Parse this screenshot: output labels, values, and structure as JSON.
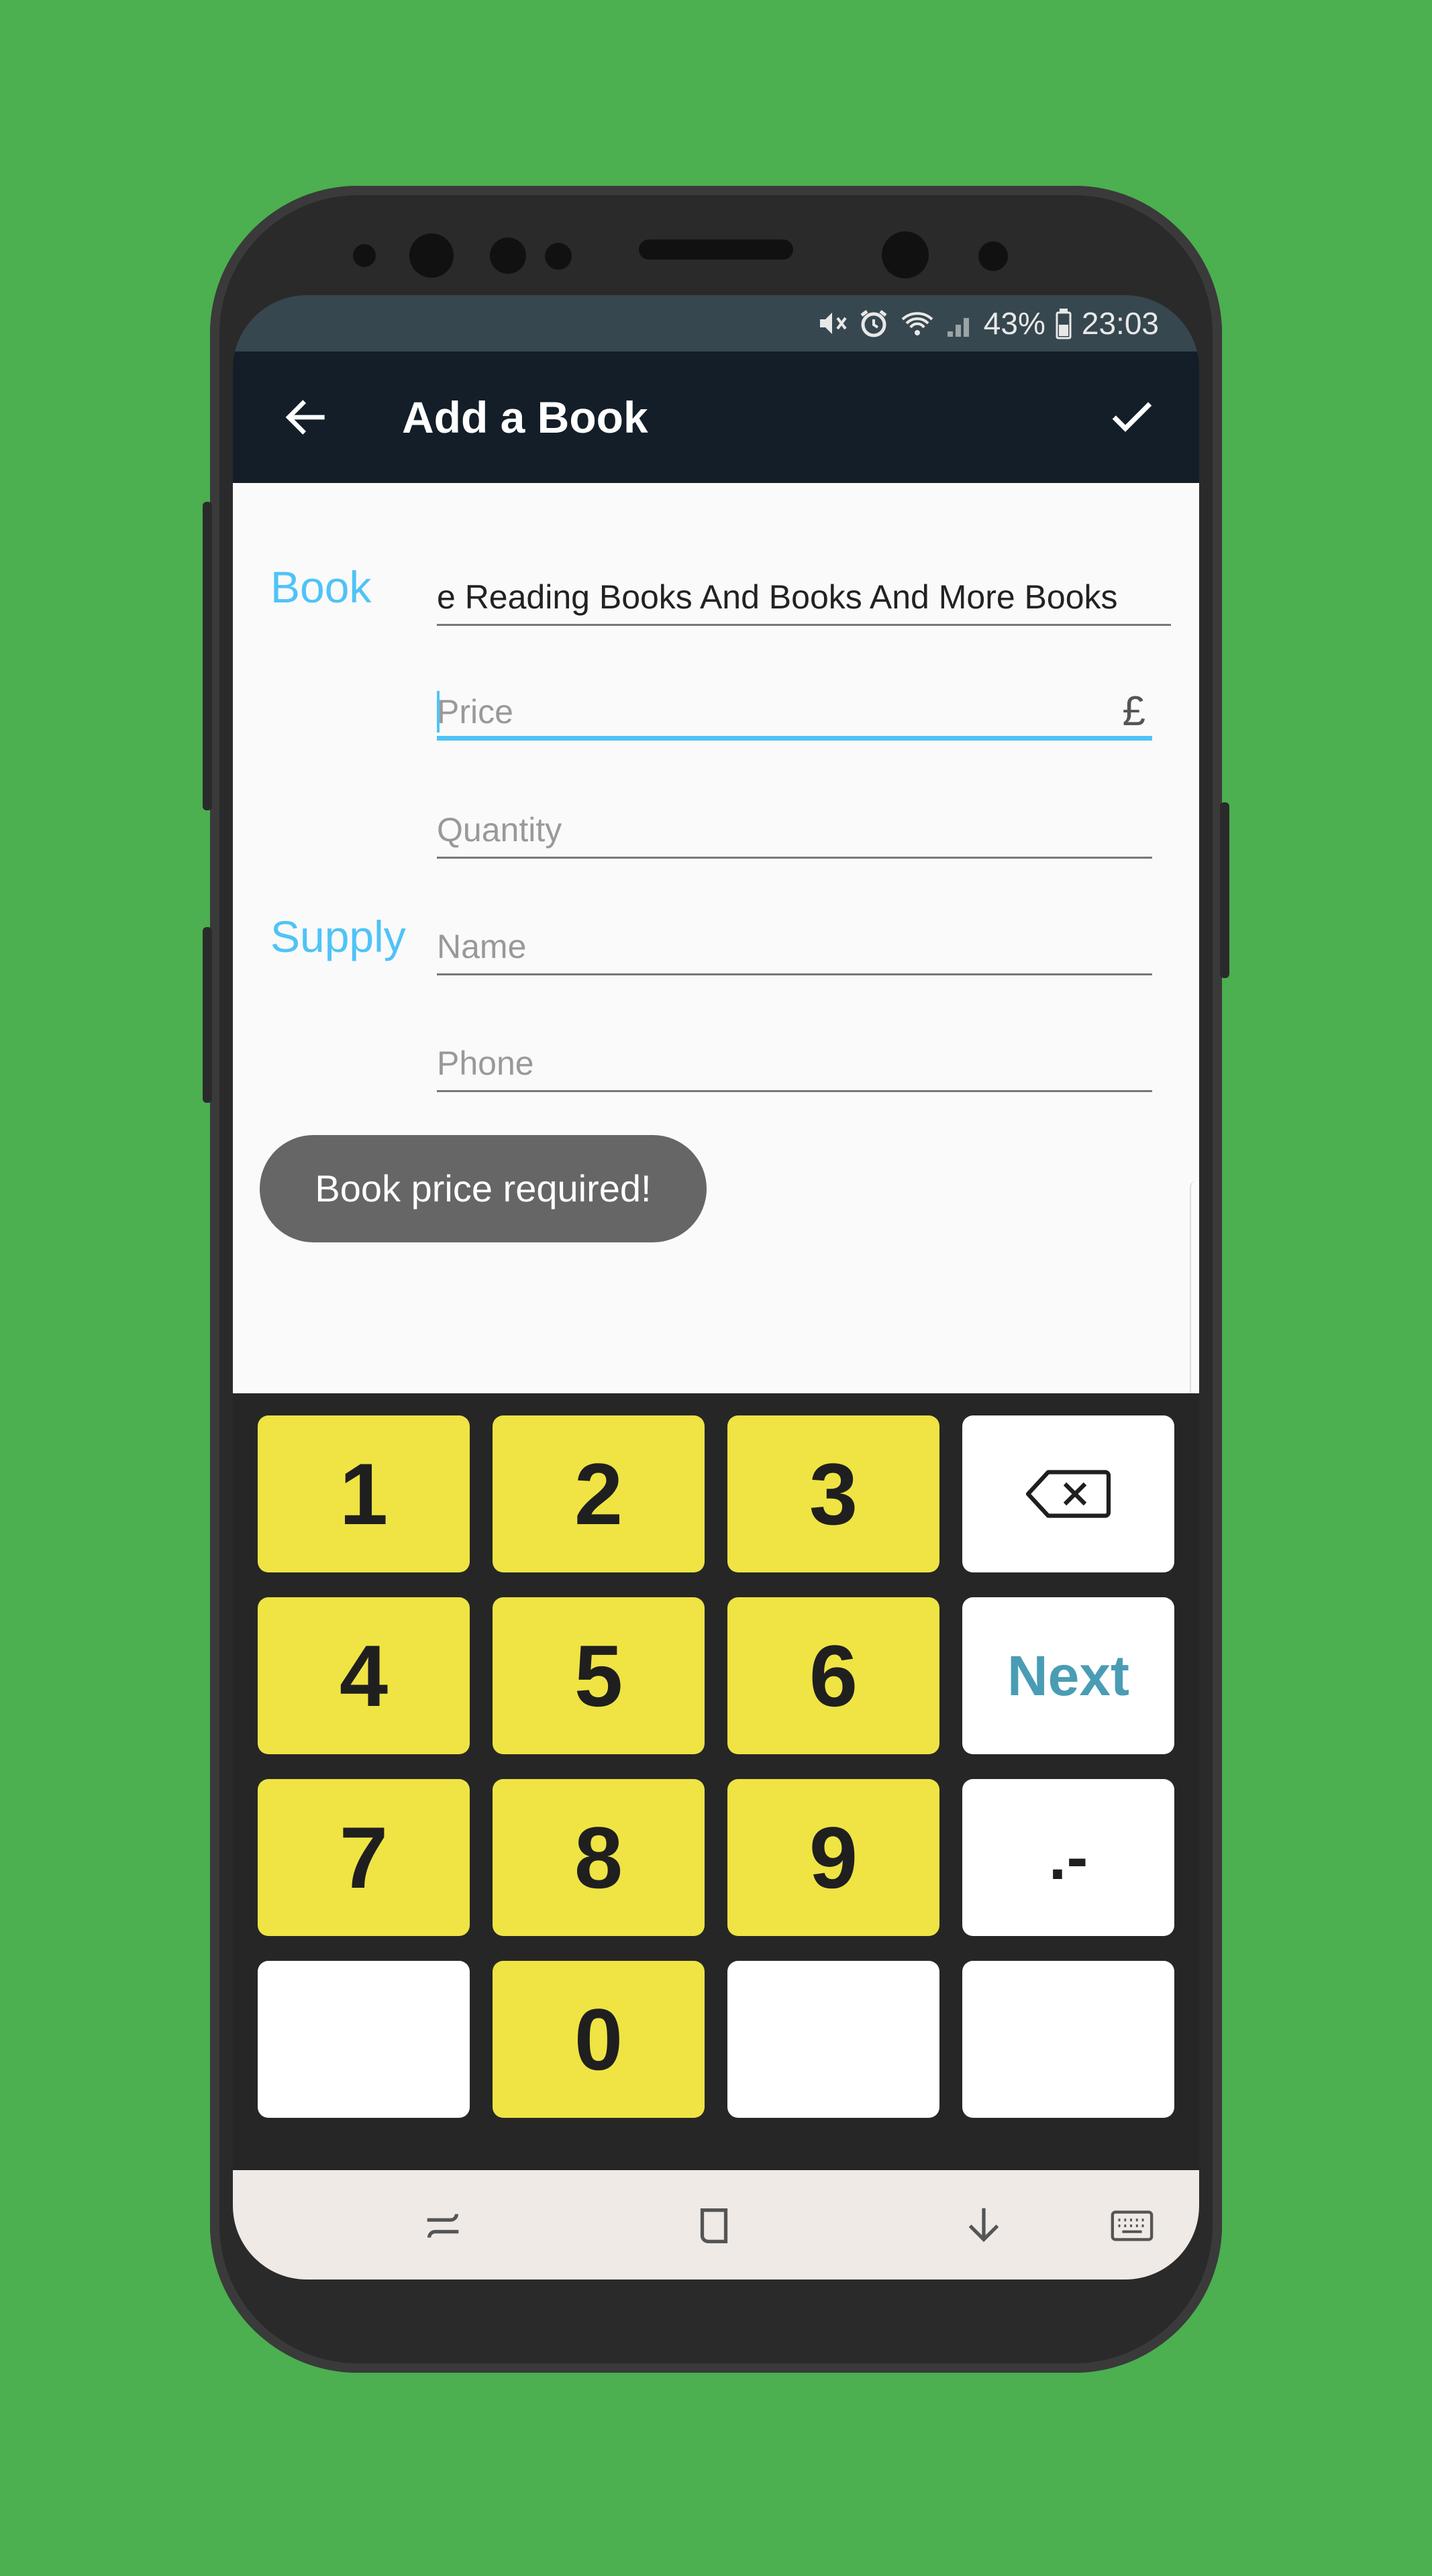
{
  "status_bar": {
    "battery": "43%",
    "time": "23:03",
    "icons": [
      "mute-icon",
      "alarm-icon",
      "wifi-icon",
      "signal-icon",
      "battery-icon"
    ]
  },
  "app_bar": {
    "title": "Add a Book",
    "back_icon": "arrow-back-icon",
    "confirm_icon": "check-icon"
  },
  "form": {
    "book_section_label": "Book",
    "supply_section_label": "Supply",
    "book_name_value": "e Reading Books And Books And More Books",
    "price_placeholder": "Price",
    "price_currency": "£",
    "quantity_placeholder": "Quantity",
    "supplier_name_placeholder": "Name",
    "supplier_phone_placeholder": "Phone"
  },
  "toast": {
    "message": "Book price required!"
  },
  "keypad": {
    "keys": [
      "1",
      "2",
      "3",
      "4",
      "5",
      "6",
      "7",
      "8",
      "9",
      "0"
    ],
    "next_label": "Next",
    "decimal_label": ".-",
    "backspace_icon": "backspace-icon"
  },
  "nav_bar": {
    "icons": [
      "recents-icon",
      "home-icon",
      "hide-keyboard-icon",
      "keyboard-icon"
    ]
  },
  "colors": {
    "background": "#4caf50",
    "accent": "#4fc3f7",
    "app_bar": "#141e28",
    "status_bar": "#37474f",
    "key_yellow": "#efe444",
    "next_label": "#4a9cb5"
  }
}
